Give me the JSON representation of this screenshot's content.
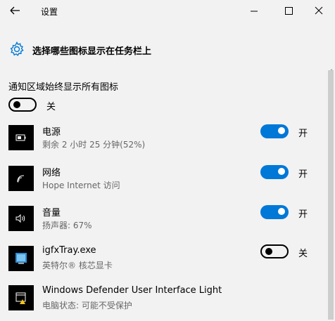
{
  "window": {
    "title": "设置",
    "back_icon": "back-arrow-icon",
    "minimize_icon": "minimize-icon",
    "maximize_icon": "maximize-icon",
    "close_icon": "close-icon"
  },
  "page": {
    "heading": "选择哪些图标显示在任务栏上",
    "heading_icon": "gear-icon"
  },
  "always_show": {
    "label": "通知区域始终显示所有图标",
    "state": "关",
    "on": false
  },
  "items": [
    {
      "title": "电源",
      "subtitle": "剩余 2 小时 25 分钟(52%)",
      "state": "开",
      "on": true,
      "icon": "battery-icon"
    },
    {
      "title": "网络",
      "subtitle": "Hope Internet 访问",
      "state": "开",
      "on": true,
      "icon": "wifi-icon"
    },
    {
      "title": "音量",
      "subtitle": "扬声器: 67%",
      "state": "开",
      "on": true,
      "icon": "speaker-icon"
    },
    {
      "title": "igfxTray.exe",
      "subtitle": "英特尔® 核芯显卡",
      "state": "关",
      "on": false,
      "icon": "intel-graphics-icon"
    },
    {
      "title": "Windows Defender User Interface Light",
      "subtitle": "电脑状态: 可能不受保护",
      "icon": "defender-icon"
    }
  ],
  "colors": {
    "accent": "#0078d7",
    "background": "#f2f2f2"
  }
}
